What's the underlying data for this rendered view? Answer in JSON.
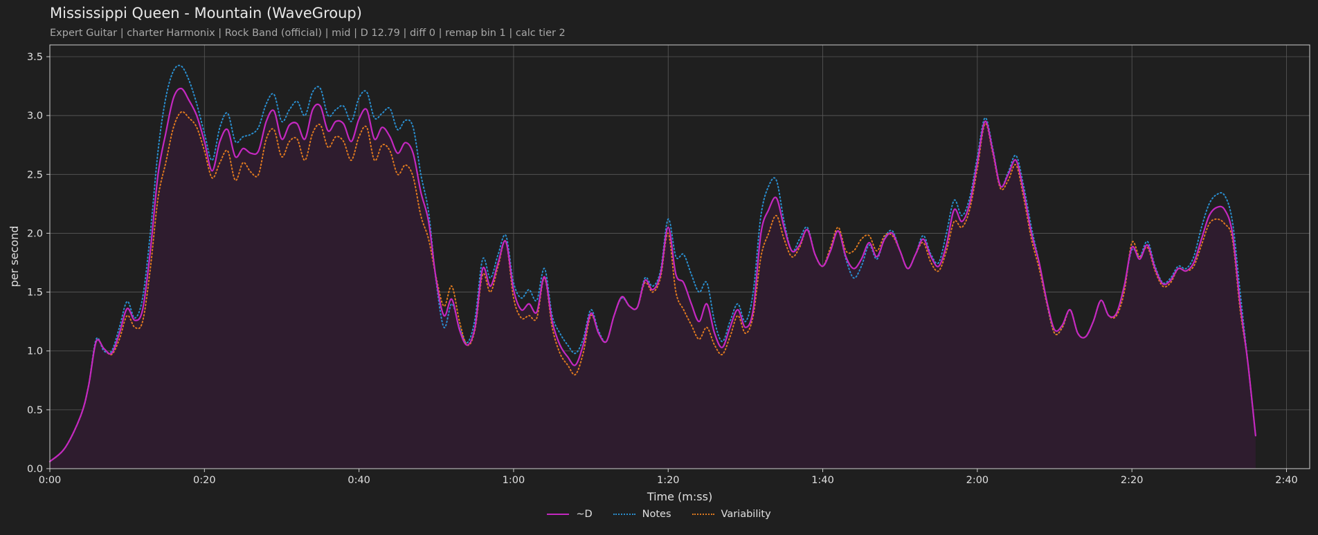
{
  "header": {
    "title": "Mississippi Queen - Mountain (WaveGroup)",
    "subtitle": "Expert Guitar  |  charter Harmonix  |  Rock Band (official)  |  mid  |  D 12.79  |  diff 0  |  remap bin 1  |  calc tier 2"
  },
  "colors": {
    "background": "#1f1f1f",
    "plot_background": "#1f1f1f",
    "d_line": "#c428c0",
    "d_fill": "#2e1c2e",
    "notes": "#2a8fd0",
    "variability": "#e07a1f",
    "grid": "#5a5a5a",
    "text": "#e0e0e0"
  },
  "chart_data": {
    "type": "line",
    "title": "Mississippi Queen - Mountain (WaveGroup)",
    "xlabel": "Time (m:ss)",
    "ylabel": "per second",
    "xlim": [
      0,
      163
    ],
    "ylim": [
      0,
      3.6
    ],
    "grid": true,
    "legend_position": "bottom-center",
    "x_ticks": [
      0,
      20,
      40,
      60,
      80,
      100,
      120,
      140,
      160
    ],
    "x_tick_labels": [
      "0:00",
      "0:20",
      "0:40",
      "1:00",
      "1:20",
      "1:40",
      "2:00",
      "2:20",
      "2:40"
    ],
    "y_ticks": [
      0.0,
      0.5,
      1.0,
      1.5,
      2.0,
      2.5,
      3.0,
      3.5
    ],
    "y_tick_labels": [
      "0.0",
      "0.5",
      "1.0",
      "1.5",
      "2.0",
      "2.5",
      "3.0",
      "3.5"
    ],
    "x": [
      0,
      2,
      4,
      5,
      6,
      7,
      8,
      9,
      10,
      11,
      12,
      13,
      14,
      15,
      16,
      17,
      18,
      19,
      20,
      21,
      22,
      23,
      24,
      25,
      26,
      27,
      28,
      29,
      30,
      31,
      32,
      33,
      34,
      35,
      36,
      37,
      38,
      39,
      40,
      41,
      42,
      43,
      44,
      45,
      46,
      47,
      48,
      49,
      50,
      51,
      52,
      53,
      54,
      55,
      56,
      57,
      58,
      59,
      60,
      61,
      62,
      63,
      64,
      65,
      66,
      67,
      68,
      69,
      70,
      71,
      72,
      73,
      74,
      75,
      76,
      77,
      78,
      79,
      80,
      81,
      82,
      83,
      84,
      85,
      86,
      87,
      88,
      89,
      90,
      91,
      92,
      93,
      94,
      95,
      96,
      97,
      98,
      99,
      100,
      101,
      102,
      103,
      104,
      105,
      106,
      107,
      108,
      109,
      110,
      111,
      112,
      113,
      114,
      115,
      116,
      117,
      118,
      119,
      120,
      121,
      122,
      123,
      124,
      125,
      126,
      127,
      128,
      129,
      130,
      131,
      132,
      133,
      134,
      135,
      136,
      137,
      138,
      139,
      140,
      141,
      142,
      143,
      144,
      145,
      146,
      147,
      148,
      149,
      150,
      151,
      152,
      153,
      154,
      155,
      156,
      157,
      158,
      159,
      160,
      161,
      162,
      163
    ],
    "series": [
      {
        "name": "~D",
        "style": "solid",
        "values": [
          0.06,
          0.18,
          0.45,
          0.7,
          1.08,
          1.02,
          0.98,
          1.15,
          1.36,
          1.26,
          1.35,
          1.85,
          2.5,
          2.85,
          3.15,
          3.23,
          3.13,
          3.0,
          2.78,
          2.53,
          2.78,
          2.88,
          2.65,
          2.72,
          2.68,
          2.7,
          2.95,
          3.04,
          2.8,
          2.92,
          2.93,
          2.8,
          3.05,
          3.08,
          2.87,
          2.95,
          2.93,
          2.78,
          2.97,
          3.05,
          2.8,
          2.9,
          2.82,
          2.68,
          2.77,
          2.68,
          2.35,
          2.1,
          1.6,
          1.3,
          1.44,
          1.18,
          1.05,
          1.2,
          1.7,
          1.55,
          1.75,
          1.93,
          1.52,
          1.35,
          1.4,
          1.33,
          1.63,
          1.25,
          1.05,
          0.95,
          0.88,
          1.05,
          1.32,
          1.15,
          1.08,
          1.3,
          1.46,
          1.38,
          1.37,
          1.6,
          1.52,
          1.65,
          2.05,
          1.65,
          1.58,
          1.4,
          1.25,
          1.4,
          1.15,
          1.03,
          1.2,
          1.35,
          1.2,
          1.35,
          2.0,
          2.2,
          2.3,
          2.05,
          1.85,
          1.9,
          2.03,
          1.82,
          1.72,
          1.85,
          2.02,
          1.8,
          1.7,
          1.78,
          1.92,
          1.8,
          1.95,
          2.0,
          1.85,
          1.7,
          1.82,
          1.95,
          1.8,
          1.72,
          1.9,
          2.2,
          2.1,
          2.25,
          2.6,
          2.95,
          2.7,
          2.4,
          2.5,
          2.62,
          2.35,
          2.0,
          1.75,
          1.42,
          1.18,
          1.22,
          1.35,
          1.15,
          1.12,
          1.25,
          1.43,
          1.3,
          1.32,
          1.55,
          1.88,
          1.78,
          1.9,
          1.7,
          1.57,
          1.6,
          1.7,
          1.68,
          1.75,
          1.95,
          2.15,
          2.22,
          2.2,
          2.0,
          1.4,
          0.9,
          0.28
        ]
      },
      {
        "name": "Notes",
        "style": "dotted",
        "values": [
          0.06,
          0.18,
          0.45,
          0.7,
          1.1,
          1.0,
          1.0,
          1.2,
          1.42,
          1.28,
          1.45,
          2.0,
          2.7,
          3.15,
          3.38,
          3.42,
          3.3,
          3.1,
          2.85,
          2.62,
          2.9,
          3.02,
          2.78,
          2.82,
          2.84,
          2.9,
          3.1,
          3.18,
          2.95,
          3.05,
          3.12,
          3.0,
          3.2,
          3.23,
          3.0,
          3.05,
          3.08,
          2.95,
          3.15,
          3.2,
          2.98,
          3.02,
          3.06,
          2.88,
          2.96,
          2.9,
          2.5,
          2.18,
          1.58,
          1.2,
          1.4,
          1.2,
          1.07,
          1.27,
          1.78,
          1.62,
          1.82,
          1.98,
          1.58,
          1.45,
          1.52,
          1.43,
          1.7,
          1.3,
          1.15,
          1.05,
          0.98,
          1.1,
          1.35,
          1.17,
          1.08,
          1.3,
          1.45,
          1.38,
          1.37,
          1.62,
          1.55,
          1.68,
          2.12,
          1.8,
          1.82,
          1.65,
          1.5,
          1.58,
          1.25,
          1.08,
          1.25,
          1.4,
          1.25,
          1.5,
          2.15,
          2.4,
          2.45,
          2.1,
          1.85,
          1.95,
          2.05,
          1.82,
          1.72,
          1.85,
          2.02,
          1.78,
          1.62,
          1.72,
          1.9,
          1.78,
          1.96,
          2.02,
          1.85,
          1.7,
          1.82,
          1.98,
          1.82,
          1.75,
          2.0,
          2.28,
          2.15,
          2.3,
          2.65,
          2.98,
          2.72,
          2.4,
          2.52,
          2.66,
          2.4,
          2.05,
          1.75,
          1.4,
          1.15,
          1.2,
          1.35,
          1.15,
          1.12,
          1.25,
          1.43,
          1.3,
          1.32,
          1.55,
          1.86,
          1.8,
          1.93,
          1.72,
          1.58,
          1.62,
          1.72,
          1.7,
          1.8,
          2.05,
          2.25,
          2.33,
          2.32,
          2.1,
          1.5,
          0.9,
          0.28
        ]
      },
      {
        "name": "Variability",
        "style": "dotted",
        "values": [
          0.06,
          0.18,
          0.45,
          0.7,
          1.08,
          1.02,
          0.97,
          1.1,
          1.3,
          1.2,
          1.25,
          1.7,
          2.3,
          2.6,
          2.9,
          3.03,
          2.98,
          2.9,
          2.7,
          2.47,
          2.6,
          2.7,
          2.45,
          2.6,
          2.52,
          2.5,
          2.8,
          2.88,
          2.65,
          2.78,
          2.8,
          2.62,
          2.85,
          2.92,
          2.73,
          2.82,
          2.78,
          2.62,
          2.82,
          2.9,
          2.62,
          2.75,
          2.7,
          2.5,
          2.58,
          2.48,
          2.15,
          1.95,
          1.62,
          1.38,
          1.55,
          1.25,
          1.05,
          1.18,
          1.65,
          1.5,
          1.72,
          1.93,
          1.45,
          1.28,
          1.3,
          1.28,
          1.62,
          1.2,
          0.98,
          0.88,
          0.8,
          0.98,
          1.3,
          1.15,
          1.08,
          1.3,
          1.46,
          1.38,
          1.37,
          1.58,
          1.5,
          1.62,
          2.0,
          1.5,
          1.35,
          1.22,
          1.1,
          1.2,
          1.05,
          0.97,
          1.12,
          1.3,
          1.15,
          1.3,
          1.8,
          2.0,
          2.15,
          1.95,
          1.8,
          1.88,
          2.03,
          1.82,
          1.72,
          1.88,
          2.05,
          1.85,
          1.85,
          1.95,
          1.98,
          1.85,
          1.98,
          1.98,
          1.85,
          1.7,
          1.82,
          1.92,
          1.75,
          1.68,
          1.85,
          2.1,
          2.05,
          2.2,
          2.55,
          2.93,
          2.68,
          2.38,
          2.45,
          2.58,
          2.3,
          1.95,
          1.7,
          1.4,
          1.15,
          1.2,
          1.35,
          1.15,
          1.12,
          1.25,
          1.43,
          1.3,
          1.3,
          1.5,
          1.92,
          1.8,
          1.88,
          1.68,
          1.55,
          1.58,
          1.7,
          1.68,
          1.72,
          1.9,
          2.08,
          2.12,
          2.08,
          1.95,
          1.35,
          0.9,
          0.28
        ]
      }
    ]
  }
}
